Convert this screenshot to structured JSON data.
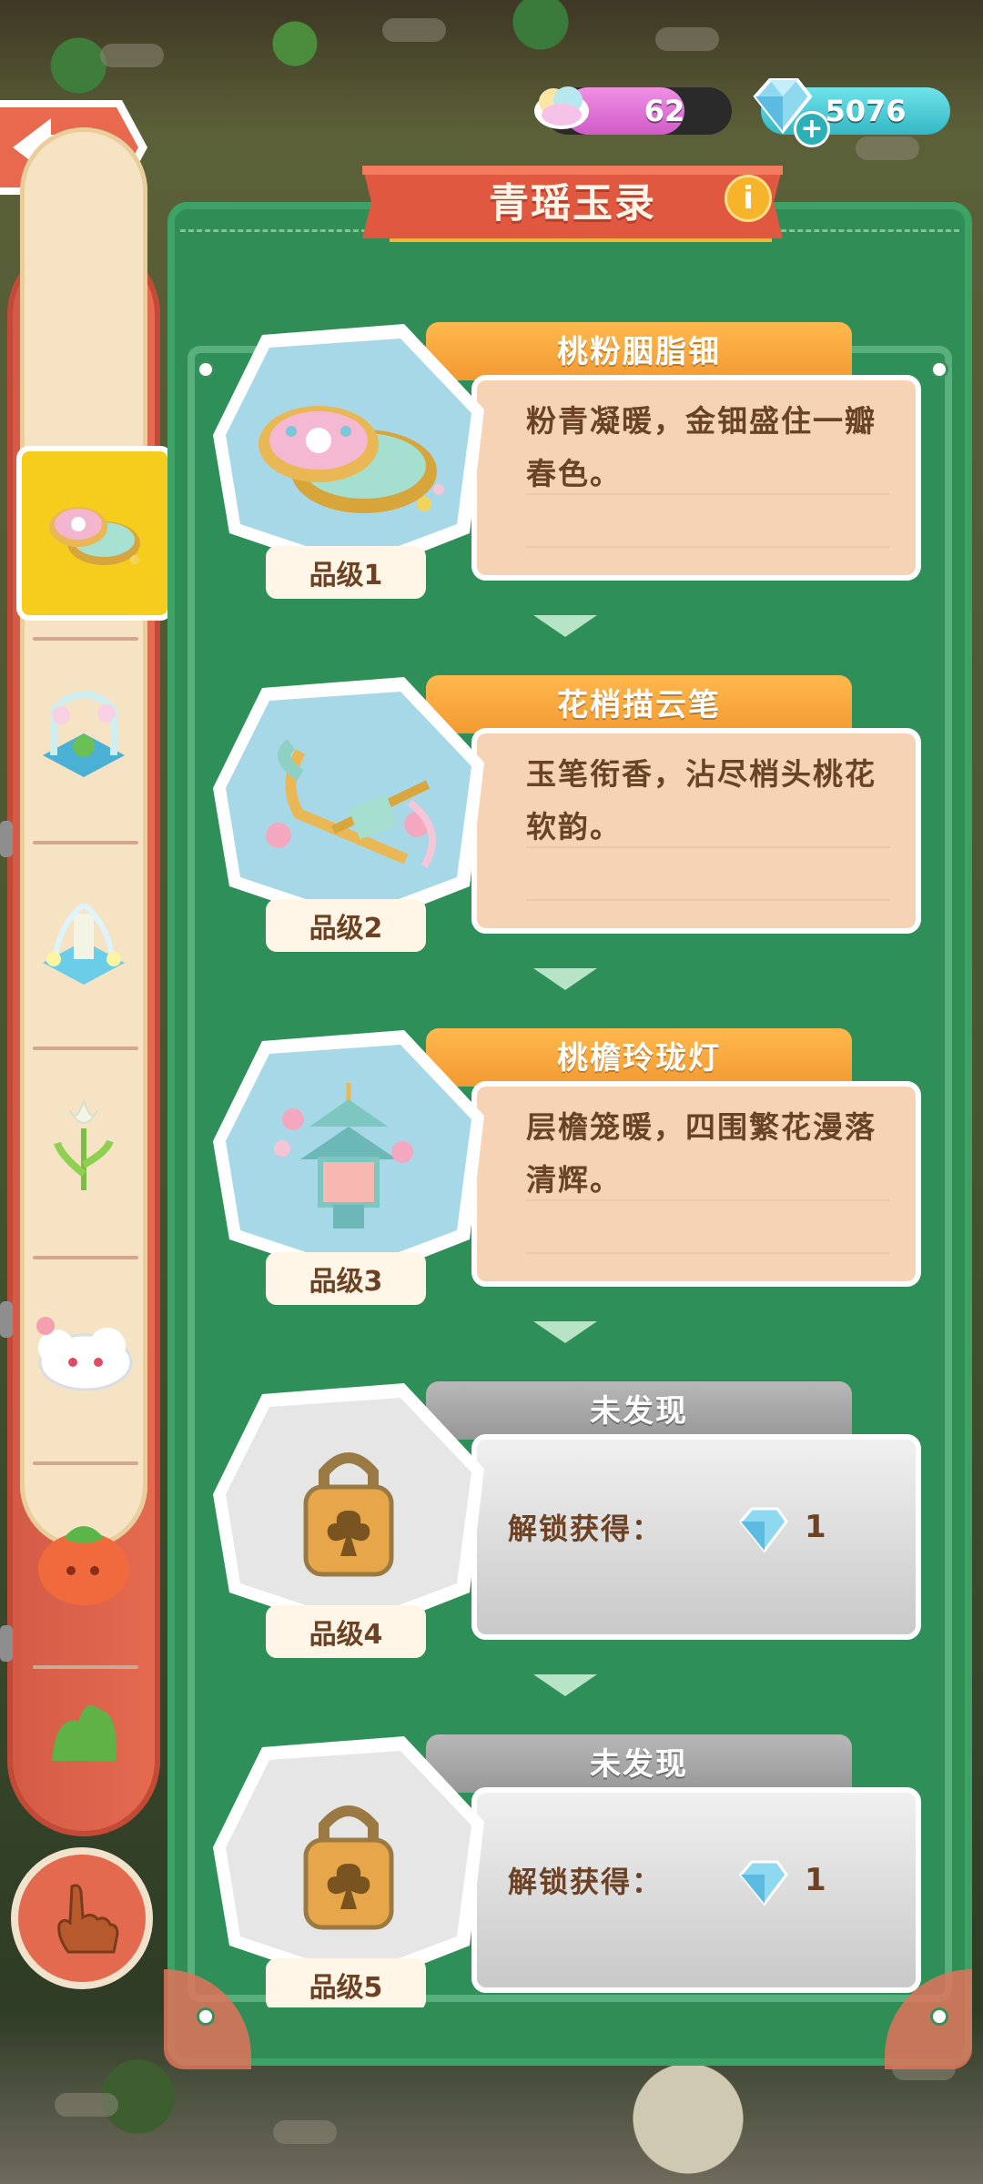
{
  "currencies": {
    "cloud": {
      "value": "62",
      "icon": "rainbow-cloud-icon"
    },
    "gem": {
      "value": "5076",
      "icon": "blue-gem-icon",
      "add_icon": "plus-icon"
    }
  },
  "header": {
    "title": "青瑶玉录",
    "info_icon": "info-icon"
  },
  "sidebar": {
    "top_icon": "collection-icon",
    "items": [
      {
        "icon": "compact-icon",
        "selected": true
      },
      {
        "icon": "flower-gazebo-icon"
      },
      {
        "icon": "fountain-icon"
      },
      {
        "icon": "tulip-icon"
      },
      {
        "icon": "cloud-creature-icon"
      },
      {
        "icon": "persimmon-icon"
      },
      {
        "icon": "leaf-icon"
      }
    ],
    "bottom_icon": "pointing-hand-icon"
  },
  "items": [
    {
      "name": "桃粉胭脂钿",
      "desc": "粉青凝暖，金钿盛住一瓣春色。",
      "grade": "品级1",
      "state": "found"
    },
    {
      "name": "花梢描云笔",
      "desc": "玉笔衔香，沾尽梢头桃花软韵。",
      "grade": "品级2",
      "state": "found"
    },
    {
      "name": "桃檐玲珑灯",
      "desc": "层檐笼暖，四围繁花漫落清辉。",
      "grade": "品级3",
      "state": "found"
    },
    {
      "name": "未发现",
      "unlock_label": "解锁获得：",
      "unlock_amount": "1",
      "grade": "品级4",
      "state": "locked"
    },
    {
      "name": "未发现",
      "unlock_label": "解锁获得：",
      "unlock_amount": "1",
      "grade": "品级5",
      "state": "locked"
    }
  ],
  "colors": {
    "panel": "#2f8d55",
    "accent_red": "#e36a4f",
    "gold": "#f29a32",
    "desc_bg": "#f6d3b4",
    "locked_gray": "#979797"
  }
}
